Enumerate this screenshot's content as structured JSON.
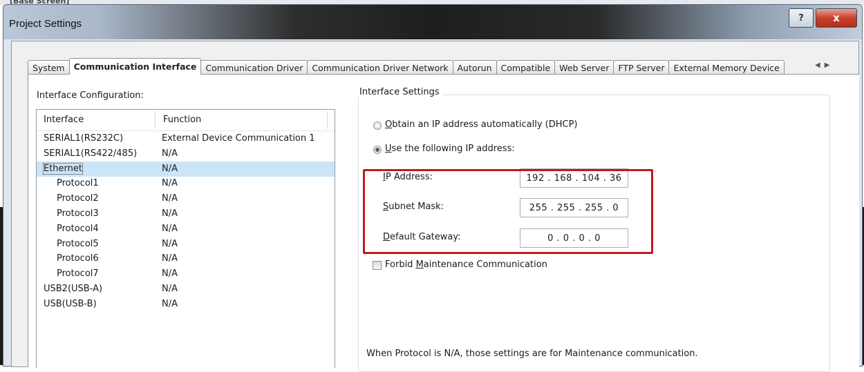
{
  "background_window_title": "[Base Screen]",
  "window": {
    "title": "Project Settings",
    "help_label": "?",
    "close_label": "x"
  },
  "tabs": [
    {
      "label": "System",
      "active": false
    },
    {
      "label": "Communication Interface",
      "active": true
    },
    {
      "label": "Communication Driver",
      "active": false
    },
    {
      "label": "Communication Driver Network",
      "active": false
    },
    {
      "label": "Autorun",
      "active": false
    },
    {
      "label": "Compatible",
      "active": false
    },
    {
      "label": "Web Server",
      "active": false
    },
    {
      "label": "FTP Server",
      "active": false
    },
    {
      "label": "External Memory Device",
      "active": false
    }
  ],
  "tab_scroll": {
    "left": "◀",
    "right": "▶"
  },
  "interface_config": {
    "label": "Interface Configuration:",
    "columns": [
      "Interface",
      "Function"
    ],
    "rows": [
      {
        "interface": "SERIAL1(RS232C)",
        "function": "External Device Communication 1",
        "indent": false,
        "selected": false
      },
      {
        "interface": "SERIAL1(RS422/485)",
        "function": "N/A",
        "indent": false,
        "selected": false
      },
      {
        "interface": "Ethernet",
        "function": "N/A",
        "indent": false,
        "selected": true
      },
      {
        "interface": "Protocol1",
        "function": "N/A",
        "indent": true,
        "selected": false
      },
      {
        "interface": "Protocol2",
        "function": "N/A",
        "indent": true,
        "selected": false
      },
      {
        "interface": "Protocol3",
        "function": "N/A",
        "indent": true,
        "selected": false
      },
      {
        "interface": "Protocol4",
        "function": "N/A",
        "indent": true,
        "selected": false
      },
      {
        "interface": "Protocol5",
        "function": "N/A",
        "indent": true,
        "selected": false
      },
      {
        "interface": "Protocol6",
        "function": "N/A",
        "indent": true,
        "selected": false
      },
      {
        "interface": "Protocol7",
        "function": "N/A",
        "indent": true,
        "selected": false
      },
      {
        "interface": "USB2(USB-A)",
        "function": "N/A",
        "indent": false,
        "selected": false
      },
      {
        "interface": "USB(USB-B)",
        "function": "N/A",
        "indent": false,
        "selected": false
      }
    ]
  },
  "interface_settings": {
    "title": "Interface Settings",
    "dhcp": {
      "mnemonic": "O",
      "rest": "btain an IP address automatically (DHCP)",
      "checked": false
    },
    "static": {
      "mnemonic": "U",
      "rest": "se the following IP address:",
      "checked": true
    },
    "ip_address": {
      "mnemonic": "I",
      "rest": "P Address:",
      "value": "192 . 168 . 104 . 36"
    },
    "subnet_mask": {
      "mnemonic": "S",
      "rest": "ubnet Mask:",
      "value": "255 . 255 . 255 . 0"
    },
    "default_gateway": {
      "mnemonic": "D",
      "rest": "efault Gateway:",
      "value": "0 . 0 . 0 . 0"
    },
    "forbid_maintenance": {
      "pre": "Forbid ",
      "mnemonic": "M",
      "rest": "aintenance Communication",
      "checked": false
    },
    "note": "When Protocol is N/A, those settings are for Maintenance communication."
  },
  "colors": {
    "highlight_box": "#c0191e",
    "selection": "#cce4f7"
  }
}
